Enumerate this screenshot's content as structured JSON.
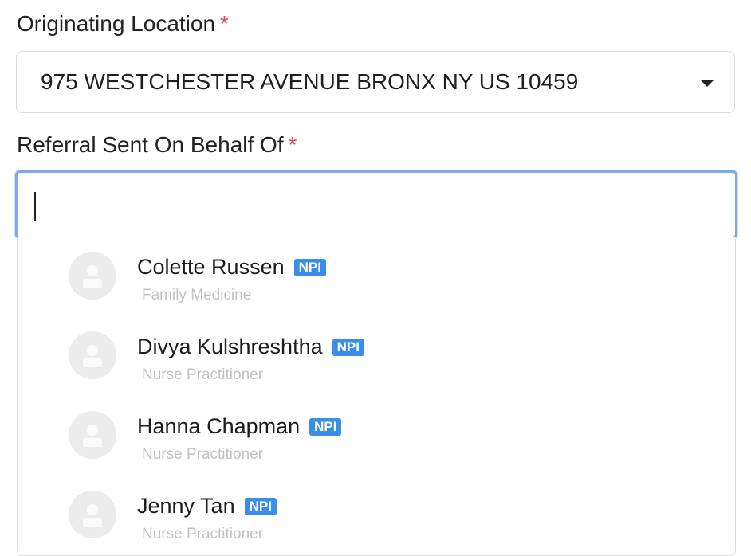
{
  "originating_location": {
    "label": "Originating Location",
    "required_marker": "*",
    "selected_value": "975 WESTCHESTER AVENUE BRONX NY US 10459",
    "icon": "chevron-down-icon"
  },
  "referral_behalf": {
    "label": "Referral Sent On Behalf Of",
    "required_marker": "*",
    "input_value": "",
    "focus_color": "#7fa9ec"
  },
  "providers": [
    {
      "name": "Colette Russen",
      "badge": "NPI",
      "specialty": "Family Medicine"
    },
    {
      "name": "Divya Kulshreshtha",
      "badge": "NPI",
      "specialty": "Nurse Practitioner"
    },
    {
      "name": "Hanna Chapman",
      "badge": "NPI",
      "specialty": "Nurse Practitioner"
    },
    {
      "name": "Jenny Tan",
      "badge": "NPI",
      "specialty": "Nurse Practitioner"
    }
  ],
  "colors": {
    "required": "#e5484d",
    "badge": "#3a8ee6",
    "secondary_text": "#c2c2c2"
  }
}
